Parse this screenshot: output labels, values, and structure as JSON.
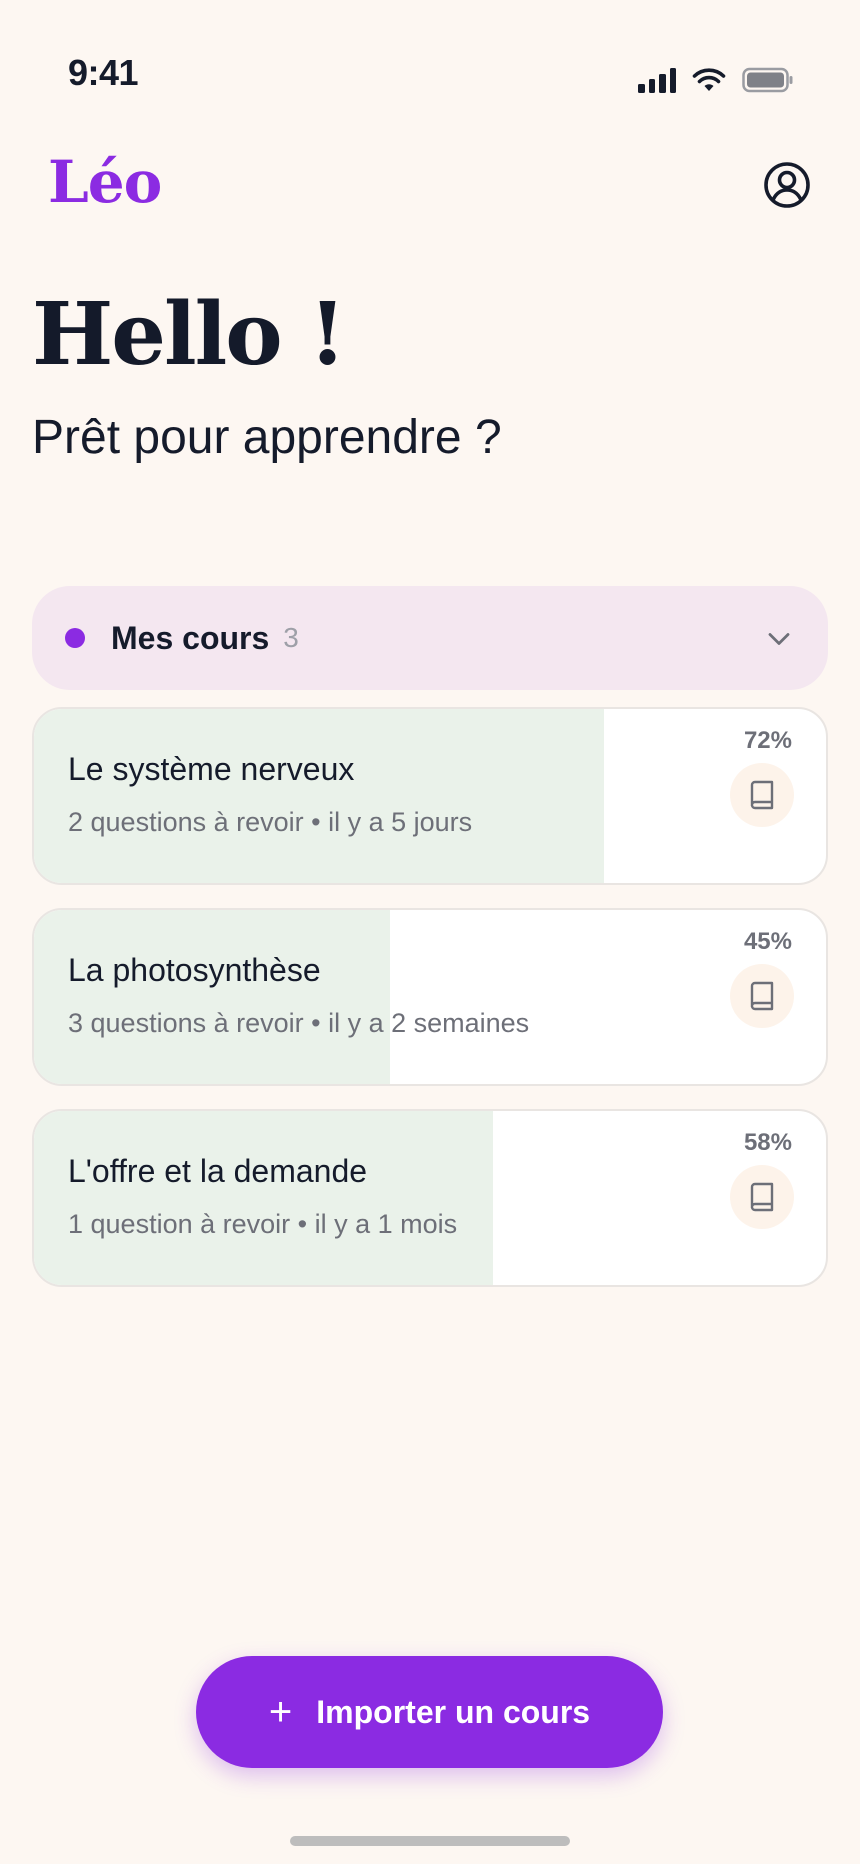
{
  "status_bar": {
    "time": "9:41",
    "icons": [
      "cellular-signal-icon",
      "wifi-icon",
      "battery-icon"
    ]
  },
  "header": {
    "logo": "Léo",
    "profile_icon": "user-circle-icon"
  },
  "greeting": {
    "title": "Hello !",
    "subtitle": "Prêt pour apprendre ?"
  },
  "section": {
    "title": "Mes cours",
    "count": "3",
    "icon": "chevron-down-icon"
  },
  "courses": [
    {
      "title": "Le système nerveux",
      "meta": "2 questions à revoir • il y a 5 jours",
      "percent": "72%",
      "progress": 72,
      "icon": "book-icon"
    },
    {
      "title": "La photosynthèse",
      "meta": "3 questions à revoir • il y a 2 semaines",
      "percent": "45%",
      "progress": 45,
      "icon": "book-icon"
    },
    {
      "title": "L'offre et la demande",
      "meta": "1 question à revoir • il y a 1 mois",
      "percent": "58%",
      "progress": 58,
      "icon": "book-icon"
    }
  ],
  "import_button": {
    "label": "Importer un cours",
    "icon": "plus-icon"
  },
  "colors": {
    "accent": "#8B2BE2",
    "background": "#FDF7F2",
    "progress_fill": "#EAF2EA",
    "section_bg": "#F4E7F0"
  }
}
